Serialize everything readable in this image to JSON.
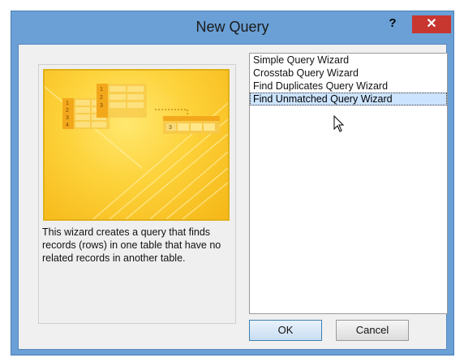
{
  "window": {
    "title": "New Query",
    "help_label": "?",
    "close_label": "✕"
  },
  "wizard": {
    "description": "This wizard creates a query that finds records (rows) in one table that have no related records in another table."
  },
  "list": {
    "items": [
      {
        "label": "Simple Query Wizard"
      },
      {
        "label": "Crosstab Query Wizard"
      },
      {
        "label": "Find Duplicates Query Wizard"
      },
      {
        "label": "Find Unmatched Query Wizard"
      }
    ],
    "selected_index": 3
  },
  "buttons": {
    "ok_label": "OK",
    "cancel_label": "Cancel"
  },
  "preview": {
    "left_table_numbers": [
      "1",
      "2",
      "3",
      "4"
    ],
    "mid_table_numbers": [
      "1",
      "2",
      "3"
    ],
    "right_table_numbers": [
      "3"
    ]
  },
  "colors": {
    "window_frame": "#6aa0d6",
    "close_button": "#c7362f",
    "selection": "#cce4ff",
    "preview_yellow": "#fdd23a"
  }
}
